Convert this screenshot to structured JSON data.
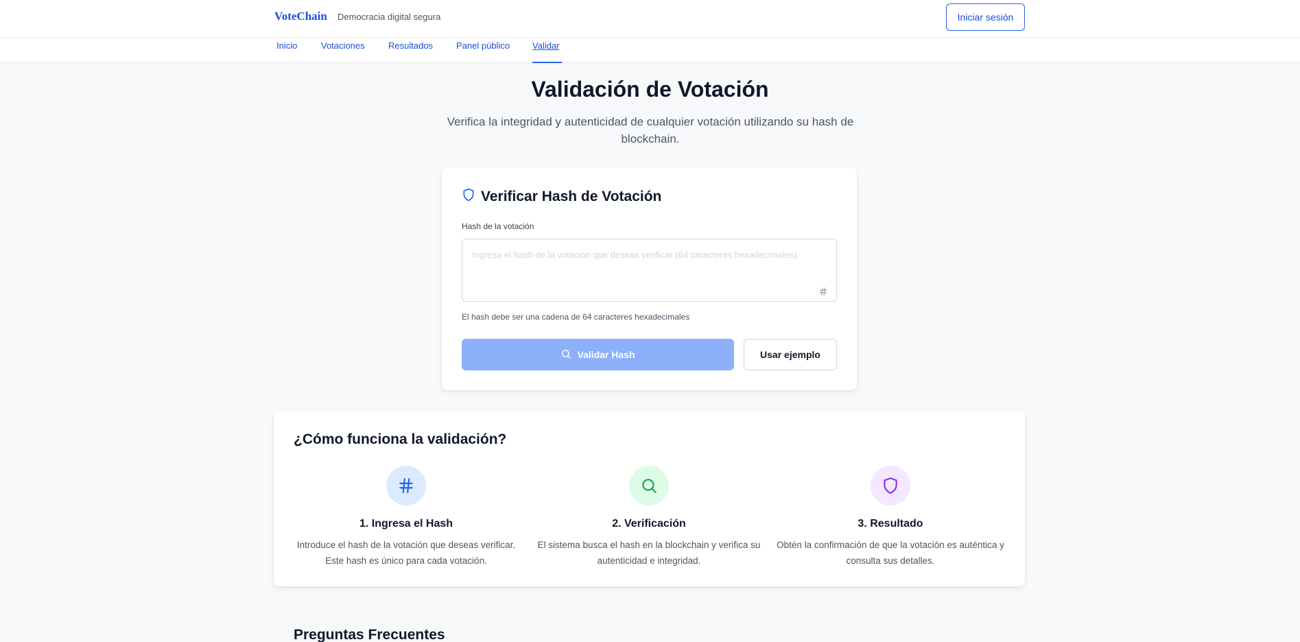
{
  "header": {
    "brand": "VoteChain",
    "tagline": "Democracia digital segura",
    "login_label": "Iniciar sesión"
  },
  "nav": {
    "items": [
      {
        "label": "Inicio"
      },
      {
        "label": "Votaciones"
      },
      {
        "label": "Resultados"
      },
      {
        "label": "Panel público"
      },
      {
        "label": "Validar",
        "active": true
      }
    ]
  },
  "page": {
    "title": "Validación de Votación",
    "subtitle": "Verifica la integridad y autenticidad de cualquier votación utilizando su hash de blockchain."
  },
  "verify": {
    "title": "Verificar Hash de Votación",
    "title_icon": "shield-icon",
    "field_label": "Hash de la votación",
    "field_value": "",
    "field_placeholder": "Ingresa el hash de la votación que deseas verificar (64 caracteres hexadecimales)",
    "helper": "El hash debe ser una cadena de 64 caracteres hexadecimales",
    "validate_label": "Validar Hash",
    "example_label": "Usar ejemplo"
  },
  "how": {
    "title": "¿Cómo funciona la validación?",
    "steps": [
      {
        "icon": "hash-icon",
        "title": "1. Ingresa el Hash",
        "desc": "Introduce el hash de la votación que deseas verificar. Este hash es único para cada votación."
      },
      {
        "icon": "search-icon",
        "title": "2. Verificación",
        "desc": "El sistema busca el hash en la blockchain y verifica su autenticidad e integridad."
      },
      {
        "icon": "shield-icon",
        "title": "3. Resultado",
        "desc": "Obtén la confirmación de que la votación es auténtica y consulta sus detalles."
      }
    ]
  },
  "faq": {
    "title": "Preguntas Frecuentes"
  },
  "colors": {
    "accent": "#2563eb",
    "button_disabled": "#8db0fb",
    "step1_bg": "#dbeafe",
    "step2_bg": "#dcfce7",
    "step3_bg": "#f3e8ff"
  }
}
